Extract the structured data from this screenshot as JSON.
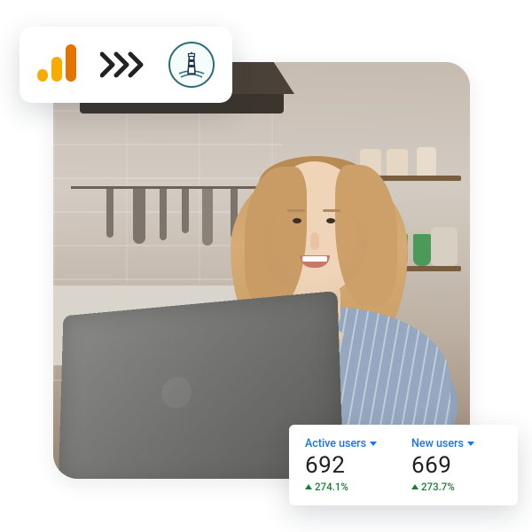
{
  "badge": {
    "source_icon": "google-analytics-icon",
    "arrow_icon": "triple-chevron-right-icon",
    "dest_icon": "lighthouse-icon"
  },
  "stats": {
    "metrics": [
      {
        "label": "Active users",
        "value": "692",
        "delta": "274.1%",
        "direction": "up"
      },
      {
        "label": "New users",
        "value": "669",
        "delta": "273.7%",
        "direction": "up"
      }
    ]
  },
  "colors": {
    "link_blue": "#1a73e8",
    "positive_green": "#188038",
    "ga_orange_light": "#f9ab00",
    "ga_orange_dark": "#e37400",
    "teal": "#2b6e77"
  }
}
